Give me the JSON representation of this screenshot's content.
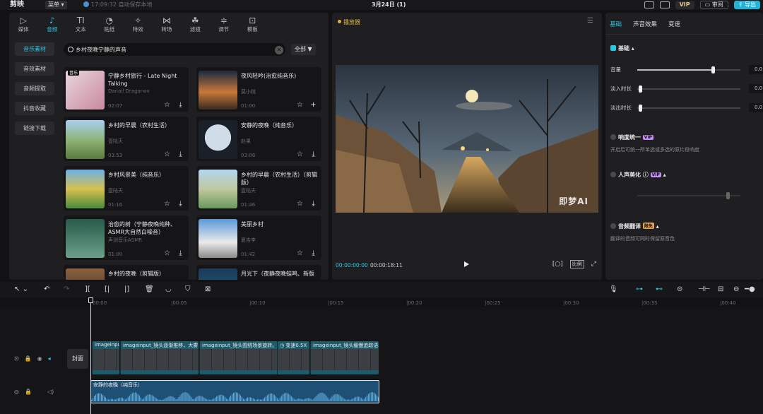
{
  "topbar": {
    "logo": "剪映",
    "menu_label": "菜单",
    "save_status": "17:09:32 自动保存本地",
    "doc_title": "3月24日 (1)",
    "vip_label": "VIP",
    "review_label": "审阅",
    "export_label": "导出"
  },
  "media": {
    "category_tabs": [
      {
        "label": "媒体",
        "icon": "media-icon",
        "glyph": "▷"
      },
      {
        "label": "音频",
        "icon": "music-note-icon",
        "glyph": "♪"
      },
      {
        "label": "文本",
        "icon": "text-icon",
        "glyph": "TI"
      },
      {
        "label": "贴纸",
        "icon": "sticker-icon",
        "glyph": "◔"
      },
      {
        "label": "特效",
        "icon": "effects-icon",
        "glyph": "✧"
      },
      {
        "label": "转场",
        "icon": "transition-icon",
        "glyph": "⋈"
      },
      {
        "label": "滤镜",
        "icon": "filter-icon",
        "glyph": "☘"
      },
      {
        "label": "调节",
        "icon": "adjust-icon",
        "glyph": "≑"
      },
      {
        "label": "模板",
        "icon": "template-icon",
        "glyph": "⊡"
      }
    ],
    "active_tab": 1,
    "side_nav": [
      "音乐素材",
      "音效素材",
      "音频提取",
      "抖音收藏",
      "链接下载"
    ],
    "search_value": "乡村夜晚宁静的声音",
    "filter_label": "全部",
    "cards": [
      {
        "title": "宁静乡村旅行 - Late Night Talking",
        "artist": "Danail Draganov",
        "duration": "02:07",
        "badge": "音乐"
      },
      {
        "title": "夜风轻吟(治愈纯音乐)",
        "artist": "莫小桃",
        "duration": "01:00",
        "badge": ""
      },
      {
        "title": "乡村的早晨（农村生活）",
        "artist": "壹陆天",
        "duration": "03:53",
        "badge": ""
      },
      {
        "title": "安静的夜晚（纯音乐）",
        "artist": "赵果",
        "duration": "03:08",
        "badge": ""
      },
      {
        "title": "乡村风景美（纯音乐）",
        "artist": "壹陆天",
        "duration": "01:16",
        "badge": ""
      },
      {
        "title": "乡村的早晨（农村生活）（剪辑版）",
        "artist": "壹陆天",
        "duration": "01:46",
        "badge": ""
      },
      {
        "title": "治愈的树（宁静夜晚纯种、ASMR大自然白噪音）",
        "artist": "声测音乐ASMR",
        "duration": "01:00",
        "badge": ""
      },
      {
        "title": "美丽乡村",
        "artist": "夏吉李",
        "duration": "01:42",
        "badge": ""
      },
      {
        "title": "乡村的夜晚（剪辑版）",
        "artist": "",
        "duration": "",
        "badge": ""
      },
      {
        "title": "月光下（夜静夜晚蛙鸣、新版",
        "artist": "",
        "duration": "",
        "badge": ""
      }
    ]
  },
  "player": {
    "title": "播放器",
    "watermark": "即梦AI",
    "time_current": "00:00:00:00",
    "time_total": "00:00:18:11",
    "ratio_label": "比例"
  },
  "props": {
    "tabs": [
      "基础",
      "声音效果",
      "变速"
    ],
    "section_basic": "基础",
    "volume_label": "音量",
    "volume_value": "0.0",
    "volume_level": 0.73,
    "fade_in_label": "淡入时长",
    "fade_in_value": "0.0",
    "fade_out_label": "淡出时长",
    "fade_out_value": "0.0",
    "loudness_label": "响度统一",
    "loudness_desc": "开启后可统一所单选或多选的原片段响度",
    "voice_label": "人声美化",
    "translate_label": "音频翻译",
    "translate_desc": "翻译的音频可同时保留原音色",
    "vip_text": "VIP",
    "tag_text": "限免"
  },
  "timeline": {
    "ruler_ticks": [
      "00:00",
      "|00:05",
      "|00:10",
      "|00:15",
      "|00:20",
      "|00:25",
      "|00:30",
      "|00:35",
      "|00:40"
    ],
    "cover_label": "封面",
    "video_clips": [
      "imageinput",
      "imageinput_镜头逐渐推移，大雾",
      "imageinput_镜头围绕场景旋转。",
      "变速0.5X",
      "imageinput_镜头缓慢追踪语"
    ],
    "audio_clip_label": "安静的夜晚（纯音乐）"
  },
  "colors": {
    "accent": "#2ec7e6",
    "player_title": "#e0b33a",
    "audio_clip": "#1e4f74",
    "video_clip": "#1d5a6a"
  }
}
